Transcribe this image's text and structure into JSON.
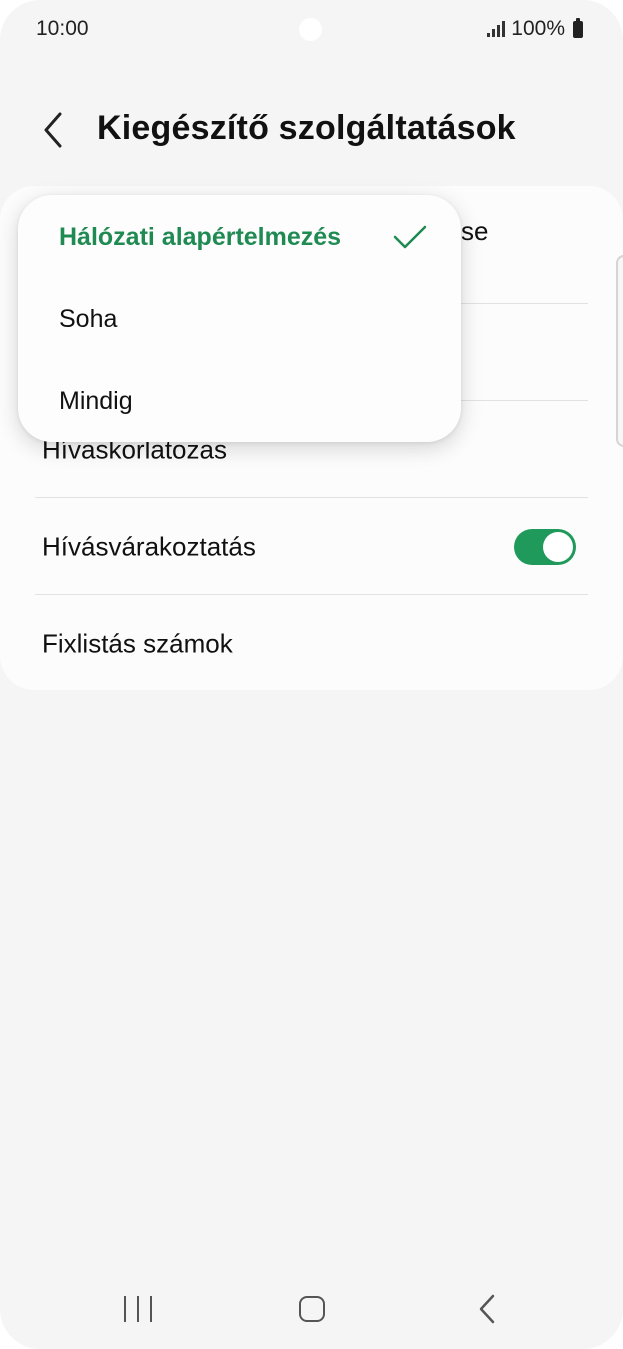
{
  "status_bar": {
    "time": "10:00",
    "battery": "100%",
    "icons": [
      "signal-icon",
      "battery-icon"
    ]
  },
  "header": {
    "title": "Kiegészítő szolgáltatások",
    "back_icon": "chevron-left-icon"
  },
  "settings": {
    "row1_partial_text": "se",
    "items": [
      {
        "label": "Hívaskorlatozas"
      },
      {
        "label": "Hívásvárakoztatás",
        "toggle_on": true
      },
      {
        "label": "Fixlistás számok"
      }
    ]
  },
  "popup": {
    "options": [
      {
        "label": "Hálózati alapértelmezés",
        "selected": true
      },
      {
        "label": "Soha",
        "selected": false
      },
      {
        "label": "Mindig",
        "selected": false
      }
    ],
    "check_icon": "check-icon"
  },
  "nav_bar": {
    "icons": [
      "recent-apps-icon",
      "home-icon",
      "back-icon"
    ]
  },
  "colors": {
    "accent": "#1f8a52",
    "toggle_on": "#1f9a5a",
    "background": "#f5f5f5",
    "card": "#fcfcfc"
  }
}
